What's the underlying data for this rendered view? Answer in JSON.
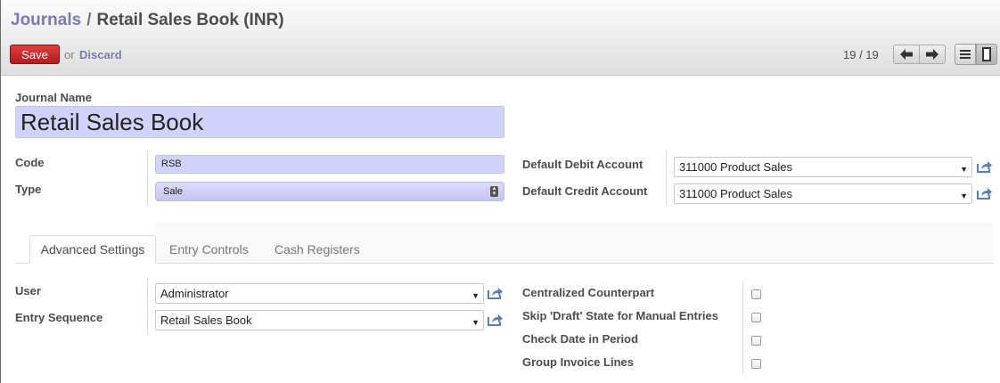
{
  "breadcrumb": {
    "parent": "Journals",
    "separator": "/",
    "current": "Retail Sales Book (INR)"
  },
  "toolbar": {
    "save_label": "Save",
    "or_text": "or",
    "discard_label": "Discard"
  },
  "pager": {
    "value": "19 / 19"
  },
  "form": {
    "journal_name_label": "Journal Name",
    "journal_name_value": "Retail Sales Book",
    "code_label": "Code",
    "code_value": "RSB",
    "type_label": "Type",
    "type_value": "Sale",
    "debit_label": "Default Debit Account",
    "debit_value": "311000 Product Sales",
    "credit_label": "Default Credit Account",
    "credit_value": "311000 Product Sales"
  },
  "tabs": [
    {
      "label": "Advanced Settings",
      "active": true
    },
    {
      "label": "Entry Controls",
      "active": false
    },
    {
      "label": "Cash Registers",
      "active": false
    }
  ],
  "advanced": {
    "user_label": "User",
    "user_value": "Administrator",
    "sequence_label": "Entry Sequence",
    "sequence_value": "Retail Sales Book",
    "checkboxes": [
      {
        "label": "Centralized Counterpart",
        "checked": false
      },
      {
        "label": "Skip 'Draft' State for Manual Entries",
        "checked": false
      },
      {
        "label": "Check Date in Period",
        "checked": false
      },
      {
        "label": "Group Invoice Lines",
        "checked": false
      }
    ]
  },
  "colors": {
    "link": "#7c7bad",
    "save": "#c62828",
    "required": "#d2d2ff"
  },
  "icons": [
    "arrow-left-icon",
    "arrow-right-icon",
    "list-view-icon",
    "form-view-icon",
    "external-link-icon",
    "dropdown-caret-icon"
  ]
}
